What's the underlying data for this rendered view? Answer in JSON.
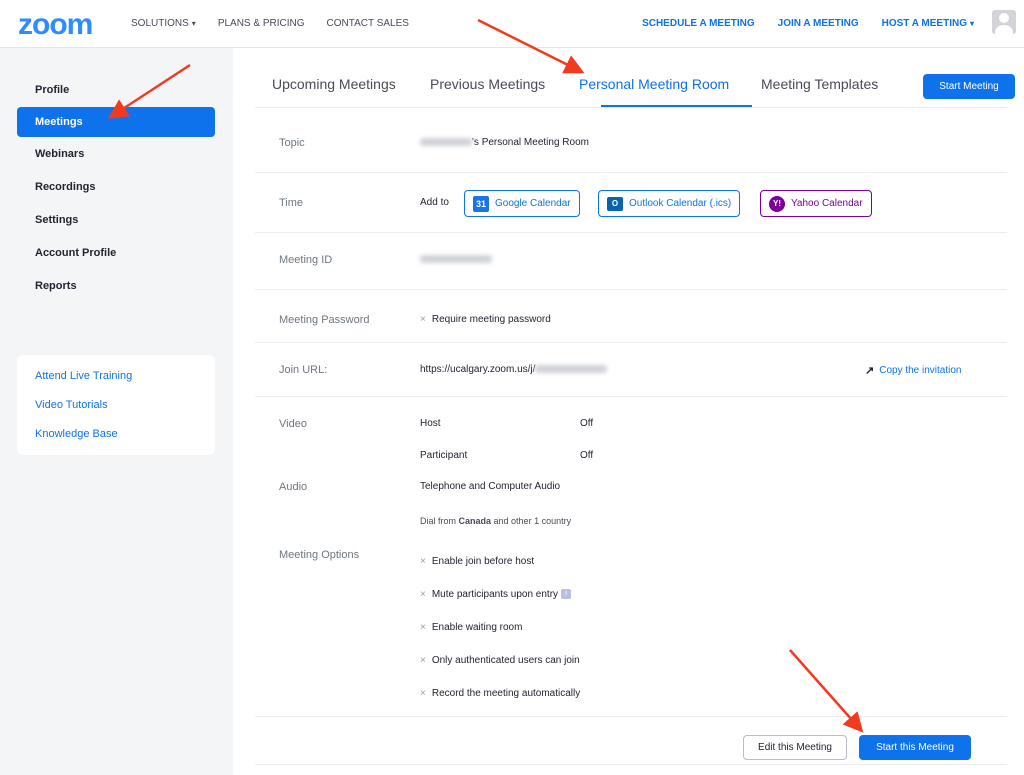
{
  "nav": {
    "logo": "zoom",
    "solutions": "SOLUTIONS",
    "plans": "PLANS & PRICING",
    "contact": "CONTACT SALES",
    "schedule": "SCHEDULE A MEETING",
    "join": "JOIN A MEETING",
    "host": "HOST A MEETING"
  },
  "sidebar": {
    "items": [
      {
        "label": "Profile"
      },
      {
        "label": "Meetings"
      },
      {
        "label": "Webinars"
      },
      {
        "label": "Recordings"
      },
      {
        "label": "Settings"
      },
      {
        "label": "Account Profile"
      },
      {
        "label": "Reports"
      }
    ],
    "help": [
      {
        "label": "Attend Live Training"
      },
      {
        "label": "Video Tutorials"
      },
      {
        "label": "Knowledge Base"
      }
    ]
  },
  "tabs": [
    {
      "label": "Upcoming Meetings"
    },
    {
      "label": "Previous Meetings"
    },
    {
      "label": "Personal Meeting Room"
    },
    {
      "label": "Meeting Templates"
    }
  ],
  "start_meeting": "Start Meeting",
  "details": {
    "topic_label": "Topic",
    "topic_value": "'s Personal Meeting Room",
    "time_label": "Time",
    "add_to": "Add to",
    "google": "Google Calendar",
    "outlook": "Outlook Calendar (.ics)",
    "yahoo": "Yahoo Calendar",
    "meeting_id_label": "Meeting ID",
    "password_label": "Meeting Password",
    "password_value": "Require meeting password",
    "join_url_label": "Join URL:",
    "join_url_value": "https://ucalgary.zoom.us/j/",
    "copy_invitation": "Copy the invitation",
    "video_label": "Video",
    "host_label": "Host",
    "host_value": "Off",
    "participant_label": "Participant",
    "participant_value": "Off",
    "audio_label": "Audio",
    "audio_value": "Telephone and Computer Audio",
    "dial_prefix": "Dial from ",
    "dial_country": "Canada",
    "dial_suffix": " and other 1 country",
    "options_label": "Meeting Options",
    "options": [
      "Enable join before host",
      "Mute participants upon entry",
      "Enable waiting room",
      "Only authenticated users can join",
      "Record the meeting automatically"
    ]
  },
  "buttons": {
    "edit": "Edit this Meeting",
    "start": "Start this Meeting"
  },
  "colors": {
    "brand_blue": "#0e72ed",
    "annotation_red": "#f23a1f",
    "yahoo_purple": "#7b0099"
  }
}
